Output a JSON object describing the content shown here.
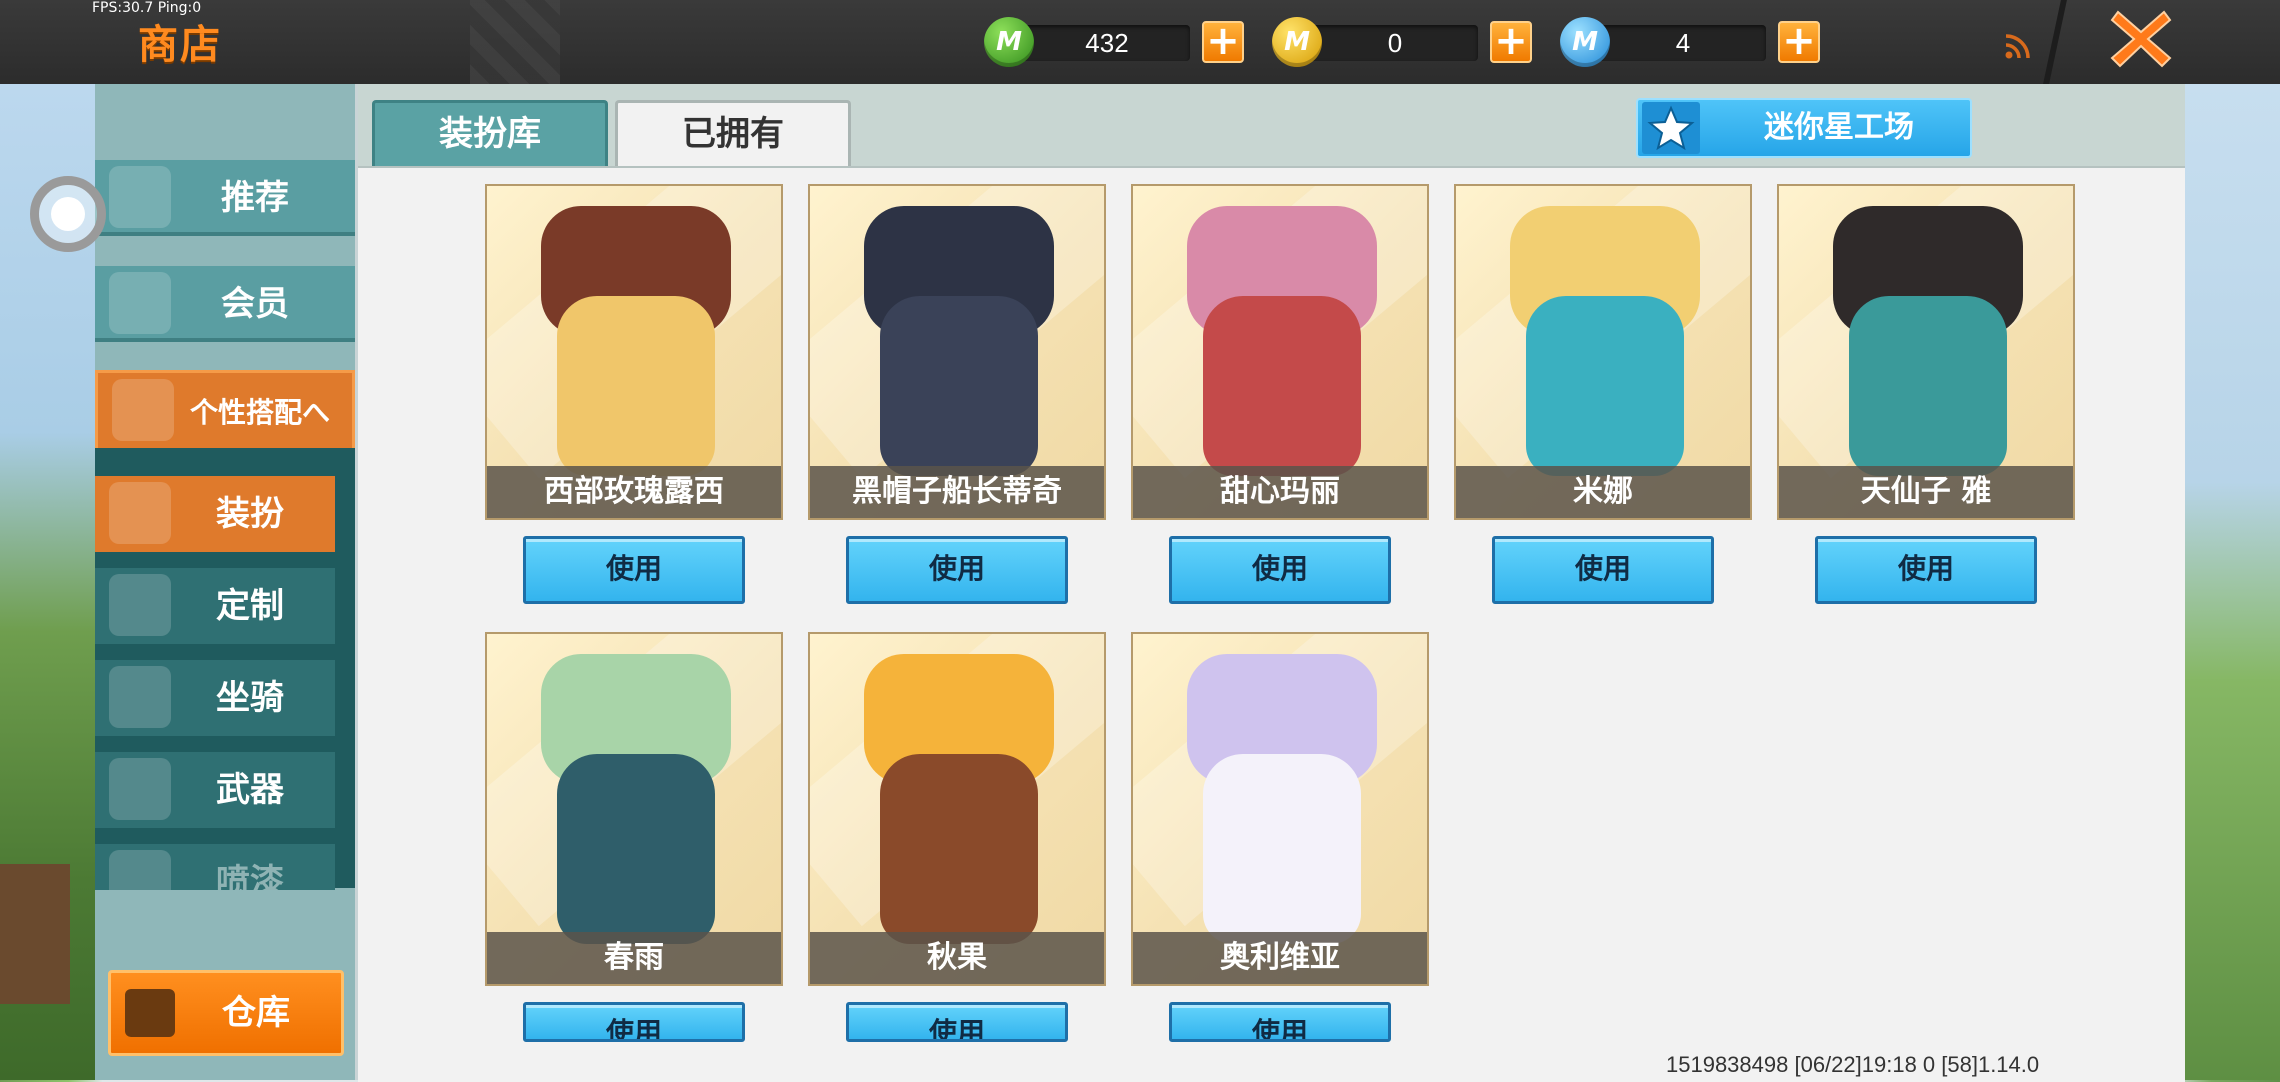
{
  "status": {
    "fps_ping": "FPS:30.7  Ping:0"
  },
  "header": {
    "title": "商店"
  },
  "currencies": [
    {
      "icon": "mini-bean-coin-icon",
      "letter": "M",
      "amount": "432"
    },
    {
      "icon": "mini-gold-coin-icon",
      "letter": "M",
      "amount": "0"
    },
    {
      "icon": "mini-point-coin-icon",
      "letter": "M",
      "amount": "4"
    }
  ],
  "tabs": {
    "costume_library": "装扮库",
    "owned": "已拥有",
    "selected": "已拥有"
  },
  "workshop": {
    "label": "迷你星工场"
  },
  "sidebar": {
    "recommend": "推荐",
    "member": "会员",
    "group": "个性搭配へ",
    "items": [
      "装扮",
      "定制",
      "坐骑",
      "武器",
      "喷漆"
    ],
    "active": "装扮",
    "warehouse": "仓库"
  },
  "cards": [
    {
      "name": "西部玫瑰露西",
      "button": "使用"
    },
    {
      "name": "黑帽子船长蒂奇",
      "button": "使用"
    },
    {
      "name": "甜心玛丽",
      "button": "使用"
    },
    {
      "name": "米娜",
      "button": "使用"
    },
    {
      "name": "天仙子 雅",
      "button": "使用"
    },
    {
      "name": "春雨",
      "button": "使用"
    },
    {
      "name": "秋果",
      "button": "使用"
    },
    {
      "name": "奥利维亚",
      "button": "使用"
    }
  ],
  "footer": {
    "info": "1519838498   [06/22]19:18 0   [58]1.14.0"
  },
  "colors": {
    "accent_orange": "#f07a00",
    "button_blue": "#33b4ee",
    "teal": "#5aa2a4"
  }
}
